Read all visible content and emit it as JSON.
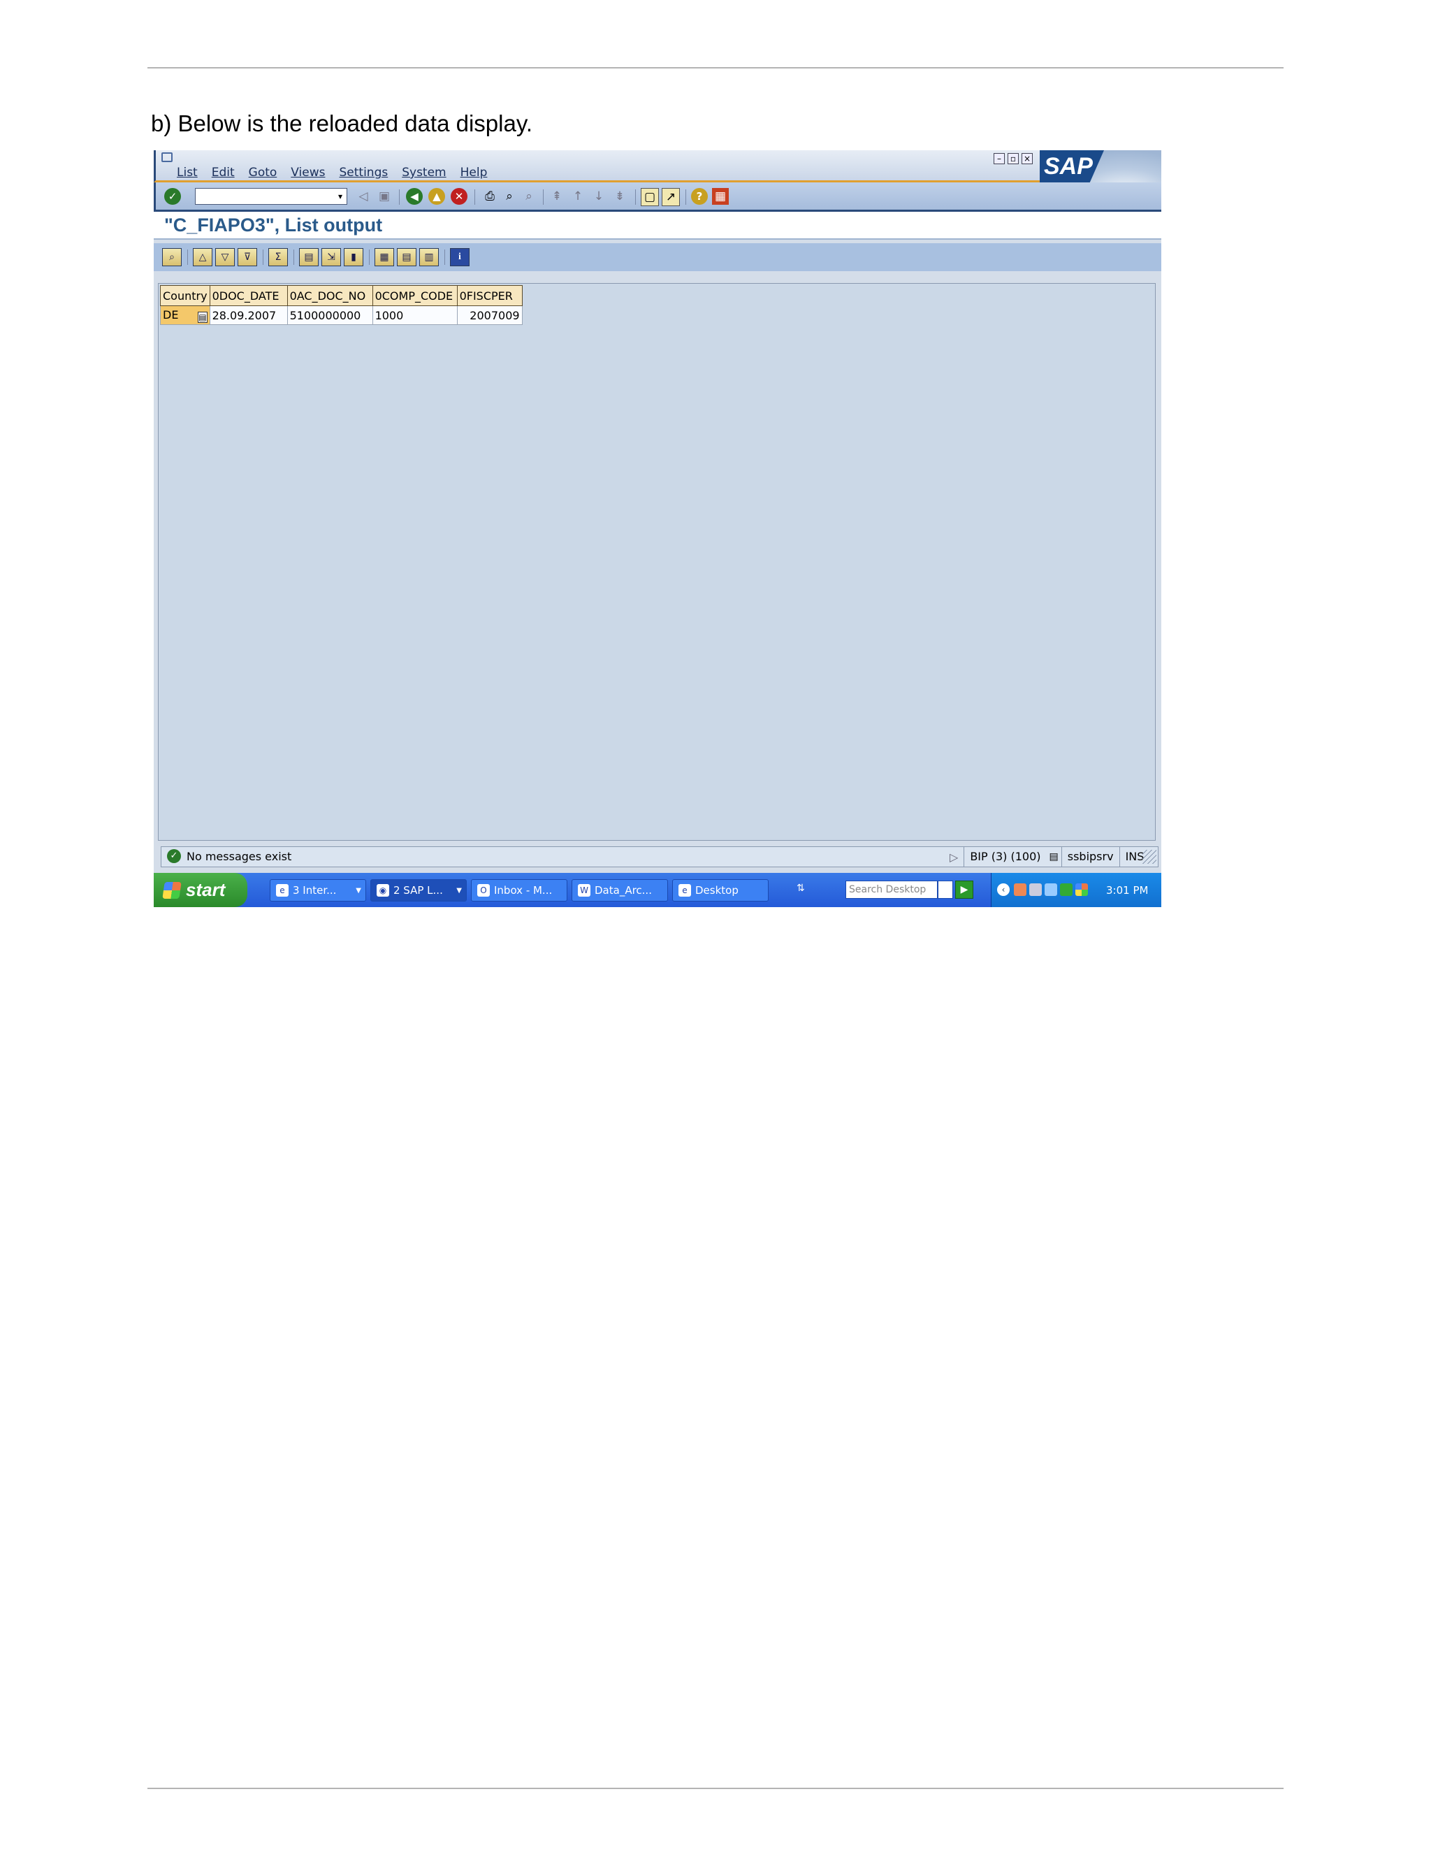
{
  "document": {
    "caption": "b) Below is the reloaded data display."
  },
  "sap": {
    "menu": [
      "List",
      "Edit",
      "Goto",
      "Views",
      "Settings",
      "System",
      "Help"
    ],
    "logo_text": "SAP",
    "title": "\"C_FIAPO3\", List output",
    "table": {
      "headers": [
        "Country",
        "0DOC_DATE",
        "0AC_DOC_NO",
        "0COMP_CODE",
        "0FISCPER"
      ],
      "rows": [
        [
          "DE",
          "28.09.2007",
          "5100000000",
          "1000",
          "2007009"
        ]
      ]
    },
    "status": {
      "message": "No messages exist",
      "system": "BIP (3) (100)",
      "server": "ssbipsrv",
      "mode": "INS"
    }
  },
  "taskbar": {
    "start_label": "start",
    "tasks": [
      "3 Inter...",
      "2 SAP L...",
      "Inbox - M...",
      "Data_Arc...",
      "Desktop"
    ],
    "search_placeholder": "Search Desktop",
    "clock": "3:01 PM"
  }
}
